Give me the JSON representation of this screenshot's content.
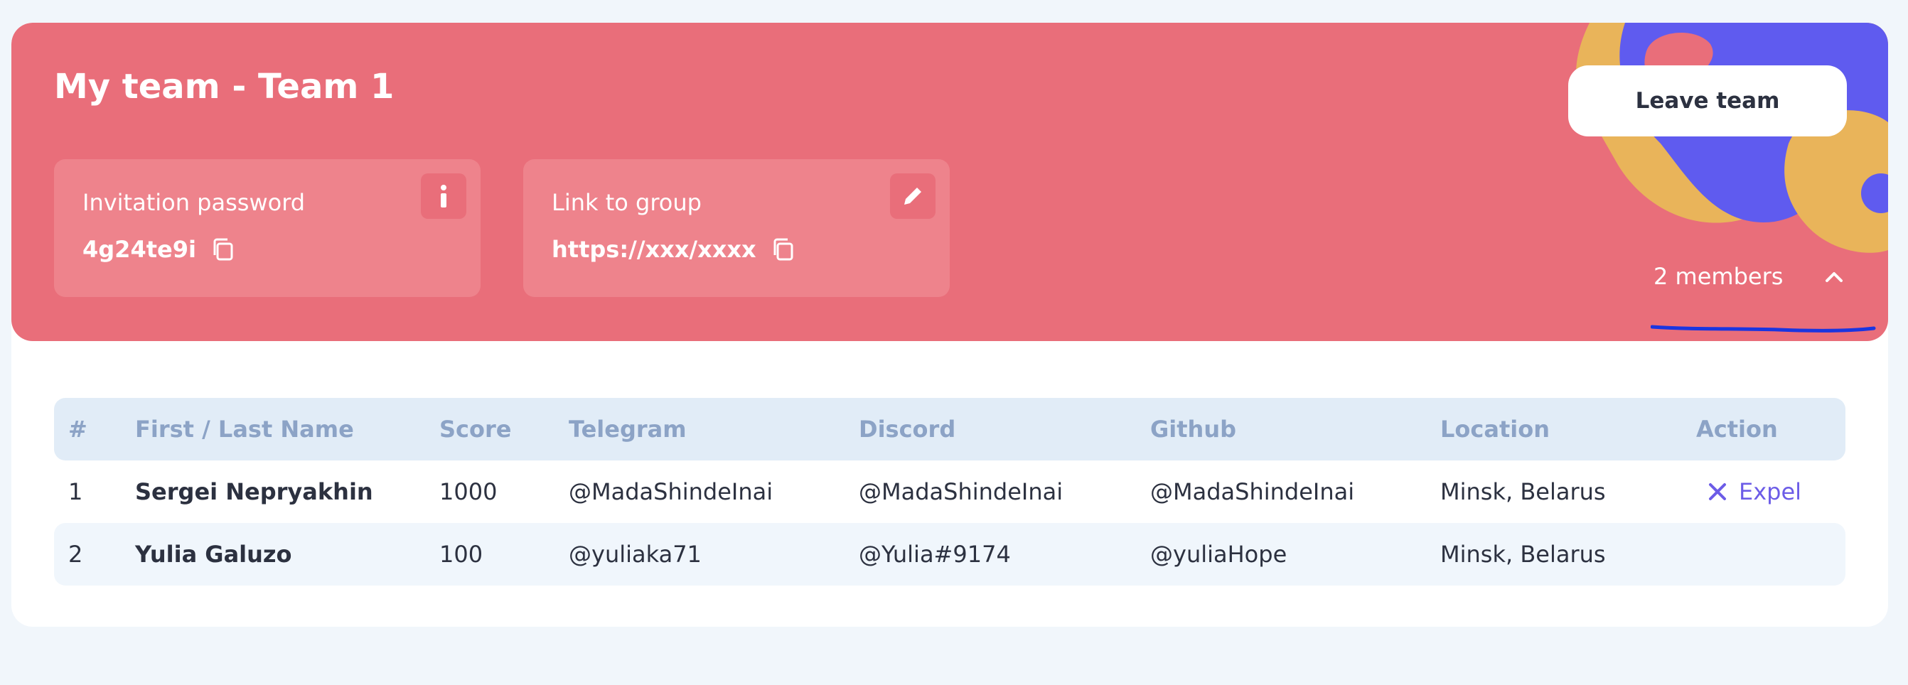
{
  "banner": {
    "title": "My team - Team 1",
    "invitation": {
      "label": "Invitation password",
      "value": "4g24te9i",
      "action_icon": "info-icon"
    },
    "group_link": {
      "label": "Link to group",
      "value": "https://xxx/xxxx",
      "action_icon": "pencil-icon"
    },
    "leave_button": "Leave team",
    "members_toggle": "2 members",
    "colors": {
      "banner": "#e96e7a",
      "box": "#ee838c",
      "blob_purple": "#5f5bef",
      "blob_yellow": "#e9b45a"
    }
  },
  "table": {
    "headers": [
      "#",
      "First / Last Name",
      "Score",
      "Telegram",
      "Discord",
      "Github",
      "Location",
      "Action"
    ],
    "rows": [
      {
        "index": "1",
        "name": "Sergei Nepryakhin",
        "score": "1000",
        "telegram": "@MadaShindeInai",
        "discord": "@MadaShindeInai",
        "github": "@MadaShindeInai",
        "location": "Minsk, Belarus",
        "action": "Expel"
      },
      {
        "index": "2",
        "name": "Yulia Galuzo",
        "score": "100",
        "telegram": "@yuliaka71",
        "discord": "@Yulia#9174",
        "github": "@yuliaHope",
        "location": "Minsk, Belarus",
        "action": ""
      }
    ],
    "colors": {
      "header_bg": "#e1ecf7",
      "header_text": "#8ca3c6",
      "accent": "#6c5ce7"
    }
  }
}
